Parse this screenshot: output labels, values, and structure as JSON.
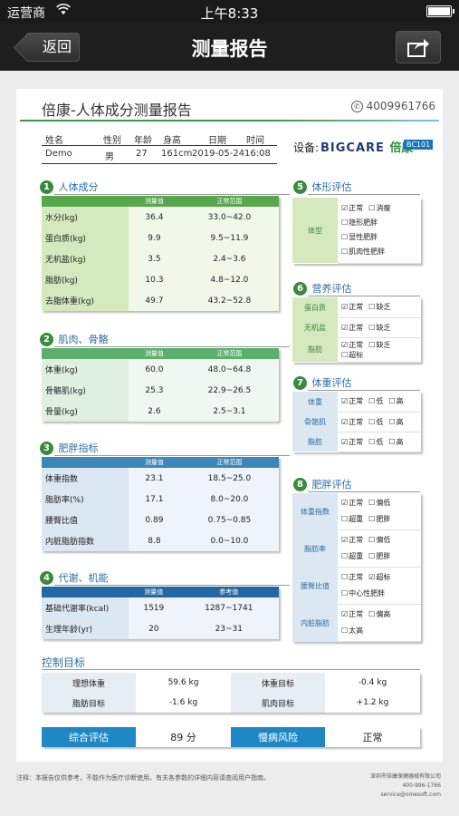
{
  "status": {
    "carrier": "运营商",
    "time": "上午8:33"
  },
  "nav": {
    "back": "返回",
    "title": "测量报告"
  },
  "report": {
    "title": "倍康-人体成分测量报告",
    "phone": "4009961766",
    "info_headers": [
      "姓名",
      "性别",
      "年龄",
      "身高",
      "日期",
      "时间"
    ],
    "info_values": [
      "Demo",
      "男",
      "27",
      "161cm",
      "2019-05-24",
      "16:08"
    ],
    "device_label": "设备:",
    "brand": "BIGCARE",
    "brand_cn": "倍康",
    "model": "BC101"
  },
  "sections": {
    "s1": {
      "num": "1",
      "title": "人体成分",
      "h1": "测量值",
      "h2": "正常范围",
      "rows": [
        {
          "label": "水分(kg)",
          "value": "36.4",
          "range": "33.0~42.0"
        },
        {
          "label": "蛋白质(kg)",
          "value": "9.9",
          "range": "9.5~11.9"
        },
        {
          "label": "无机盐(kg)",
          "value": "3.5",
          "range": "2.4~3.6"
        },
        {
          "label": "脂肪(kg)",
          "value": "10.3",
          "range": "4.8~12.0"
        },
        {
          "label": "去脂体重(kg)",
          "value": "49.7",
          "range": "43.2~52.8"
        }
      ]
    },
    "s2": {
      "num": "2",
      "title": "肌肉、骨骼",
      "h1": "测量值",
      "h2": "正常范围",
      "rows": [
        {
          "label": "体重(kg)",
          "value": "60.0",
          "range": "48.0~64.8"
        },
        {
          "label": "骨骼肌(kg)",
          "value": "25.3",
          "range": "22.9~26.5"
        },
        {
          "label": "骨量(kg)",
          "value": "2.6",
          "range": "2.5~3.1"
        }
      ]
    },
    "s3": {
      "num": "3",
      "title": "肥胖指标",
      "h1": "测量值",
      "h2": "正常范围",
      "rows": [
        {
          "label": "体重指数",
          "value": "23.1",
          "range": "18.5~25.0"
        },
        {
          "label": "脂肪率(%)",
          "value": "17.1",
          "range": "8.0~20.0"
        },
        {
          "label": "腰臀比值",
          "value": "0.89",
          "range": "0.75~0.85"
        },
        {
          "label": "内脏脂肪指数",
          "value": "8.8",
          "range": "0.0~10.0"
        }
      ]
    },
    "s4": {
      "num": "4",
      "title": "代谢、机能",
      "h1": "测量值",
      "h2": "参考值",
      "rows": [
        {
          "label": "基础代谢率(kcal)",
          "value": "1519",
          "range": "1287~1741"
        },
        {
          "label": "生理年龄(yr)",
          "value": "20",
          "range": "23~31"
        }
      ]
    },
    "s5": {
      "num": "5",
      "title": "体形评估",
      "label": "体型",
      "options": [
        "正常",
        "消瘦",
        "隐形肥胖",
        "显性肥胖",
        "肌肉性肥胖"
      ],
      "checked": "正常"
    },
    "s6": {
      "num": "6",
      "title": "营养评估",
      "rows": [
        {
          "label": "蛋白质",
          "options": [
            "正常",
            "缺乏"
          ],
          "checked": "正常"
        },
        {
          "label": "无机盐",
          "options": [
            "正常",
            "缺乏"
          ],
          "checked": "正常"
        },
        {
          "label": "脂肪",
          "options": [
            "正常",
            "缺乏",
            "超标"
          ],
          "checked": "正常"
        }
      ]
    },
    "s7": {
      "num": "7",
      "title": "体重评估",
      "rows": [
        {
          "label": "体重",
          "options": [
            "正常",
            "低",
            "高"
          ],
          "checked": "正常"
        },
        {
          "label": "骨骼肌",
          "options": [
            "正常",
            "低",
            "高"
          ],
          "checked": "正常"
        },
        {
          "label": "脂肪",
          "options": [
            "正常",
            "低",
            "高"
          ],
          "checked": "正常"
        }
      ]
    },
    "s8": {
      "num": "8",
      "title": "肥胖评估",
      "rows": [
        {
          "label": "体重指数",
          "options": [
            "正常",
            "偏低",
            "超重",
            "肥胖"
          ],
          "checked": "正常"
        },
        {
          "label": "脂肪率",
          "options": [
            "正常",
            "偏低",
            "超重",
            "肥胖"
          ],
          "checked": "正常"
        },
        {
          "label": "腰臀比值",
          "options": [
            "正常",
            "超标",
            "中心性肥胖"
          ],
          "checked": "超标"
        },
        {
          "label": "内脏脂肪",
          "options": [
            "正常",
            "偏高",
            "太高"
          ],
          "checked": "正常"
        }
      ]
    }
  },
  "control": {
    "title": "控制目标",
    "rows": [
      [
        {
          "label": "理想体重",
          "value": "59.6 kg"
        },
        {
          "label": "体重目标",
          "value": "-0.4 kg"
        }
      ],
      [
        {
          "label": "脂肪目标",
          "value": "-1.6 kg"
        },
        {
          "label": "肌肉目标",
          "value": "+1.2 kg"
        }
      ]
    ]
  },
  "summary": {
    "score_label": "综合评估",
    "score": "89 分",
    "risk_label": "慢病风险",
    "risk": "正常"
  },
  "footer": {
    "note": "注释：本报告仅供参考，不能作为医疗诊断使用。有关各参数的详细内容请查阅用户指南。",
    "company": "深圳市倍康保健器械有限公司",
    "tel": "400-996-1766",
    "email": "service@omesoft.com"
  }
}
